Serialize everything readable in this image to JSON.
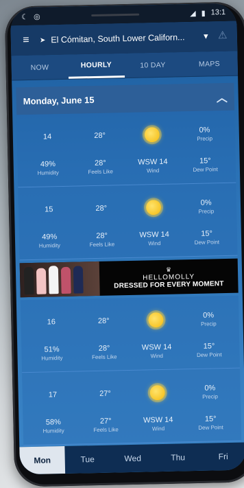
{
  "status": {
    "left_icons": [
      "moon-icon",
      "alarm-icon"
    ],
    "right_text": "13:1",
    "signal": "4"
  },
  "header": {
    "location": "El Cómitan, South Lower Californ...",
    "location_arrow": "➤",
    "caret": "▼"
  },
  "tabs": [
    {
      "label": "NOW"
    },
    {
      "label": "HOURLY",
      "active": true
    },
    {
      "label": "10 DAY"
    },
    {
      "label": "MAPS"
    }
  ],
  "day": {
    "title": "Monday, June 15"
  },
  "labels": {
    "humidity": "Humidity",
    "feels_like": "Feels Like",
    "wind": "Wind",
    "dew_point": "Dew Point",
    "precip": "Precip"
  },
  "hours": [
    {
      "hour": "14",
      "temp": "28°",
      "precip": "0%",
      "humidity": "49%",
      "feels": "28°",
      "wind": "WSW 14",
      "dew": "15°"
    },
    {
      "hour": "15",
      "temp": "28°",
      "precip": "0%",
      "humidity": "49%",
      "feels": "28°",
      "wind": "WSW 14",
      "dew": "15°"
    },
    {
      "hour": "16",
      "temp": "28°",
      "precip": "0%",
      "humidity": "51%",
      "feels": "28°",
      "wind": "WSW 14",
      "dew": "15°"
    },
    {
      "hour": "17",
      "temp": "27°",
      "precip": "0%",
      "humidity": "58%",
      "feels": "27°",
      "wind": "WSW 14",
      "dew": "15°"
    }
  ],
  "ad": {
    "brand": "HELLOMOLLY",
    "tagline": "DRESSED FOR EVERY MOMENT"
  },
  "days": [
    {
      "label": "Mon",
      "active": true
    },
    {
      "label": "Tue"
    },
    {
      "label": "Wed"
    },
    {
      "label": "Thu"
    },
    {
      "label": "Fri"
    }
  ]
}
